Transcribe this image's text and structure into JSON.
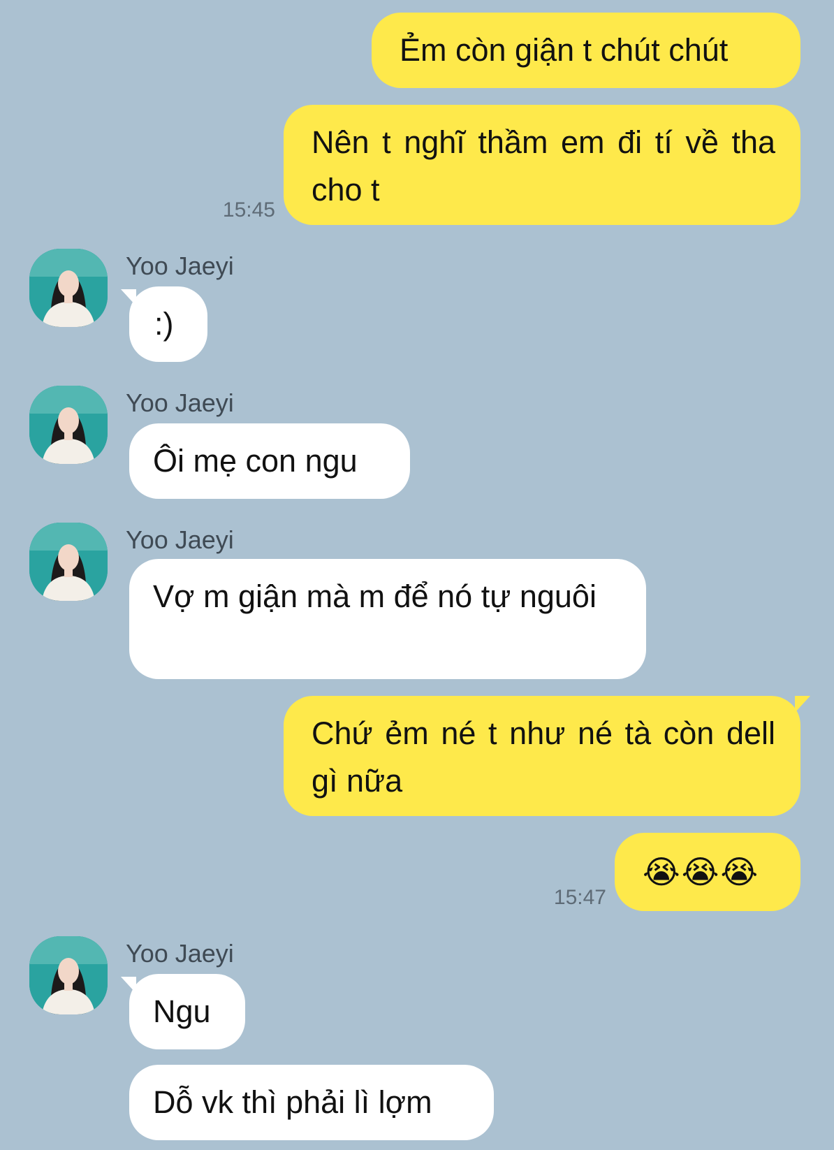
{
  "contact": {
    "name": "Yoo Jaeyi"
  },
  "colors": {
    "background": "#abc1d1",
    "my_bubble": "#fee94b",
    "their_bubble": "#ffffff"
  },
  "messages": [
    {
      "from": "me",
      "text": "Ẻm còn giận t chút chút"
    },
    {
      "from": "me",
      "text": "Nên t nghĩ thầm em đi tí về tha cho t",
      "time": "15:45"
    },
    {
      "from": "them",
      "sender": "Yoo Jaeyi",
      "text": ":)"
    },
    {
      "from": "them",
      "sender": "Yoo Jaeyi",
      "text": "Ôi mẹ con ngu"
    },
    {
      "from": "them",
      "sender": "Yoo Jaeyi",
      "text": "Vợ m giận mà m để nó tự nguôi"
    },
    {
      "from": "me",
      "text": "Chứ ẻm né t như né tà còn dell gì nữa"
    },
    {
      "from": "me",
      "text": "😭😭😭",
      "emoji_icon": "loudly-crying-face",
      "time": "15:47"
    },
    {
      "from": "them",
      "sender": "Yoo Jaeyi",
      "text": "Ngu"
    },
    {
      "from": "them",
      "text": "Dỗ vk thì phải lì lợm"
    }
  ]
}
